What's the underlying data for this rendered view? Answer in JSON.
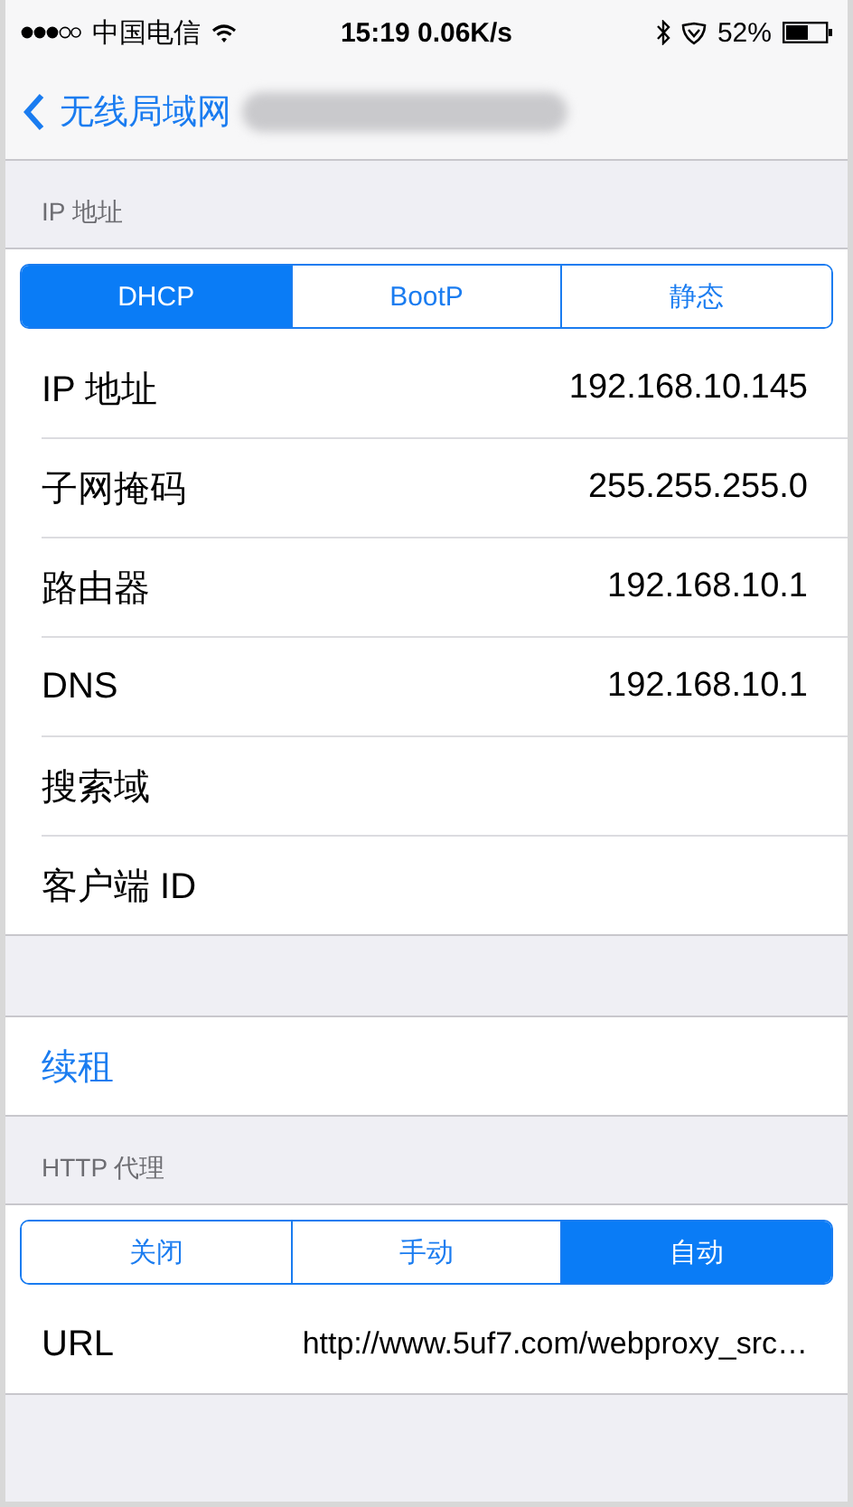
{
  "status_bar": {
    "carrier": "中国电信",
    "time": "15:19 0.06K/s",
    "battery": "52%"
  },
  "nav": {
    "back": "无线局域网"
  },
  "ip_section": {
    "header": "IP 地址",
    "segments": [
      {
        "label": "DHCP",
        "selected": true
      },
      {
        "label": "BootP",
        "selected": false
      },
      {
        "label": "静态",
        "selected": false
      }
    ],
    "rows": [
      {
        "label": "IP 地址",
        "value": "192.168.10.145"
      },
      {
        "label": "子网掩码",
        "value": "255.255.255.0"
      },
      {
        "label": "路由器",
        "value": "192.168.10.1"
      },
      {
        "label": "DNS",
        "value": "192.168.10.1"
      },
      {
        "label": "搜索域"
      },
      {
        "label": "客户端 ID"
      }
    ]
  },
  "renew": {
    "label": "续租"
  },
  "proxy_section": {
    "header": "HTTP 代理",
    "segments": [
      {
        "label": "关闭",
        "selected": false
      },
      {
        "label": "手动",
        "selected": false
      },
      {
        "label": "自动",
        "selected": true
      }
    ],
    "rows": [
      {
        "label": "URL",
        "value": "http://www.5uf7.com/webproxy_src…"
      }
    ]
  }
}
